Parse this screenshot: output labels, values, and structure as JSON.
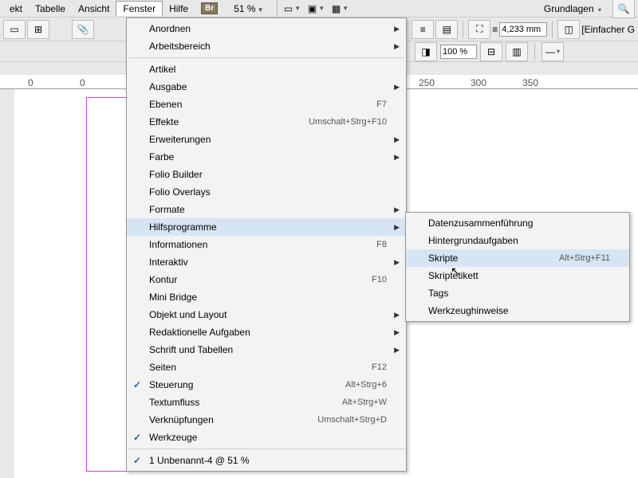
{
  "menubar": {
    "items": [
      "ekt",
      "Tabelle",
      "Ansicht",
      "Fenster",
      "Hilfe"
    ],
    "active_index": 3,
    "zoom": "51 %",
    "workspace": "Grundlagen"
  },
  "toolbar": {
    "stroke_input": "4,233 mm",
    "percent": "100 %",
    "effect_label": "[Einfacher G"
  },
  "ruler": {
    "ticks": [
      {
        "pos": 35,
        "label": "0"
      },
      {
        "pos": 100,
        "label": "0"
      },
      {
        "pos": 525,
        "label": "250"
      },
      {
        "pos": 590,
        "label": "300"
      },
      {
        "pos": 655,
        "label": "350"
      }
    ]
  },
  "menu": {
    "items": [
      {
        "label": "Anordnen",
        "arrow": true
      },
      {
        "label": "Arbeitsbereich",
        "arrow": true
      },
      {
        "sep": true
      },
      {
        "label": "Artikel"
      },
      {
        "label": "Ausgabe",
        "arrow": true
      },
      {
        "label": "Ebenen",
        "shortcut": "F7"
      },
      {
        "label": "Effekte",
        "shortcut": "Umschalt+Strg+F10"
      },
      {
        "label": "Erweiterungen",
        "arrow": true
      },
      {
        "label": "Farbe",
        "arrow": true
      },
      {
        "label": "Folio Builder"
      },
      {
        "label": "Folio Overlays"
      },
      {
        "label": "Formate",
        "arrow": true
      },
      {
        "label": "Hilfsprogramme",
        "arrow": true,
        "hover": true
      },
      {
        "label": "Informationen",
        "shortcut": "F8"
      },
      {
        "label": "Interaktiv",
        "arrow": true
      },
      {
        "label": "Kontur",
        "shortcut": "F10"
      },
      {
        "label": "Mini Bridge"
      },
      {
        "label": "Objekt und Layout",
        "arrow": true
      },
      {
        "label": "Redaktionelle Aufgaben",
        "arrow": true
      },
      {
        "label": "Schrift und Tabellen",
        "arrow": true
      },
      {
        "label": "Seiten",
        "shortcut": "F12"
      },
      {
        "label": "Steuerung",
        "shortcut": "Alt+Strg+6",
        "check": true
      },
      {
        "label": "Textumfluss",
        "shortcut": "Alt+Strg+W"
      },
      {
        "label": "Verknüpfungen",
        "shortcut": "Umschalt+Strg+D"
      },
      {
        "label": "Werkzeuge",
        "check": true
      },
      {
        "sep": true
      },
      {
        "label": "1 Unbenannt-4 @ 51 %",
        "check": true
      }
    ]
  },
  "submenu": {
    "items": [
      {
        "label": "Datenzusammenführung"
      },
      {
        "label": "Hintergrundaufgaben"
      },
      {
        "label": "Skripte",
        "shortcut": "Alt+Strg+F11",
        "hover": true
      },
      {
        "label": "Skriptetikett"
      },
      {
        "label": "Tags"
      },
      {
        "label": "Werkzeughinweise"
      }
    ]
  }
}
